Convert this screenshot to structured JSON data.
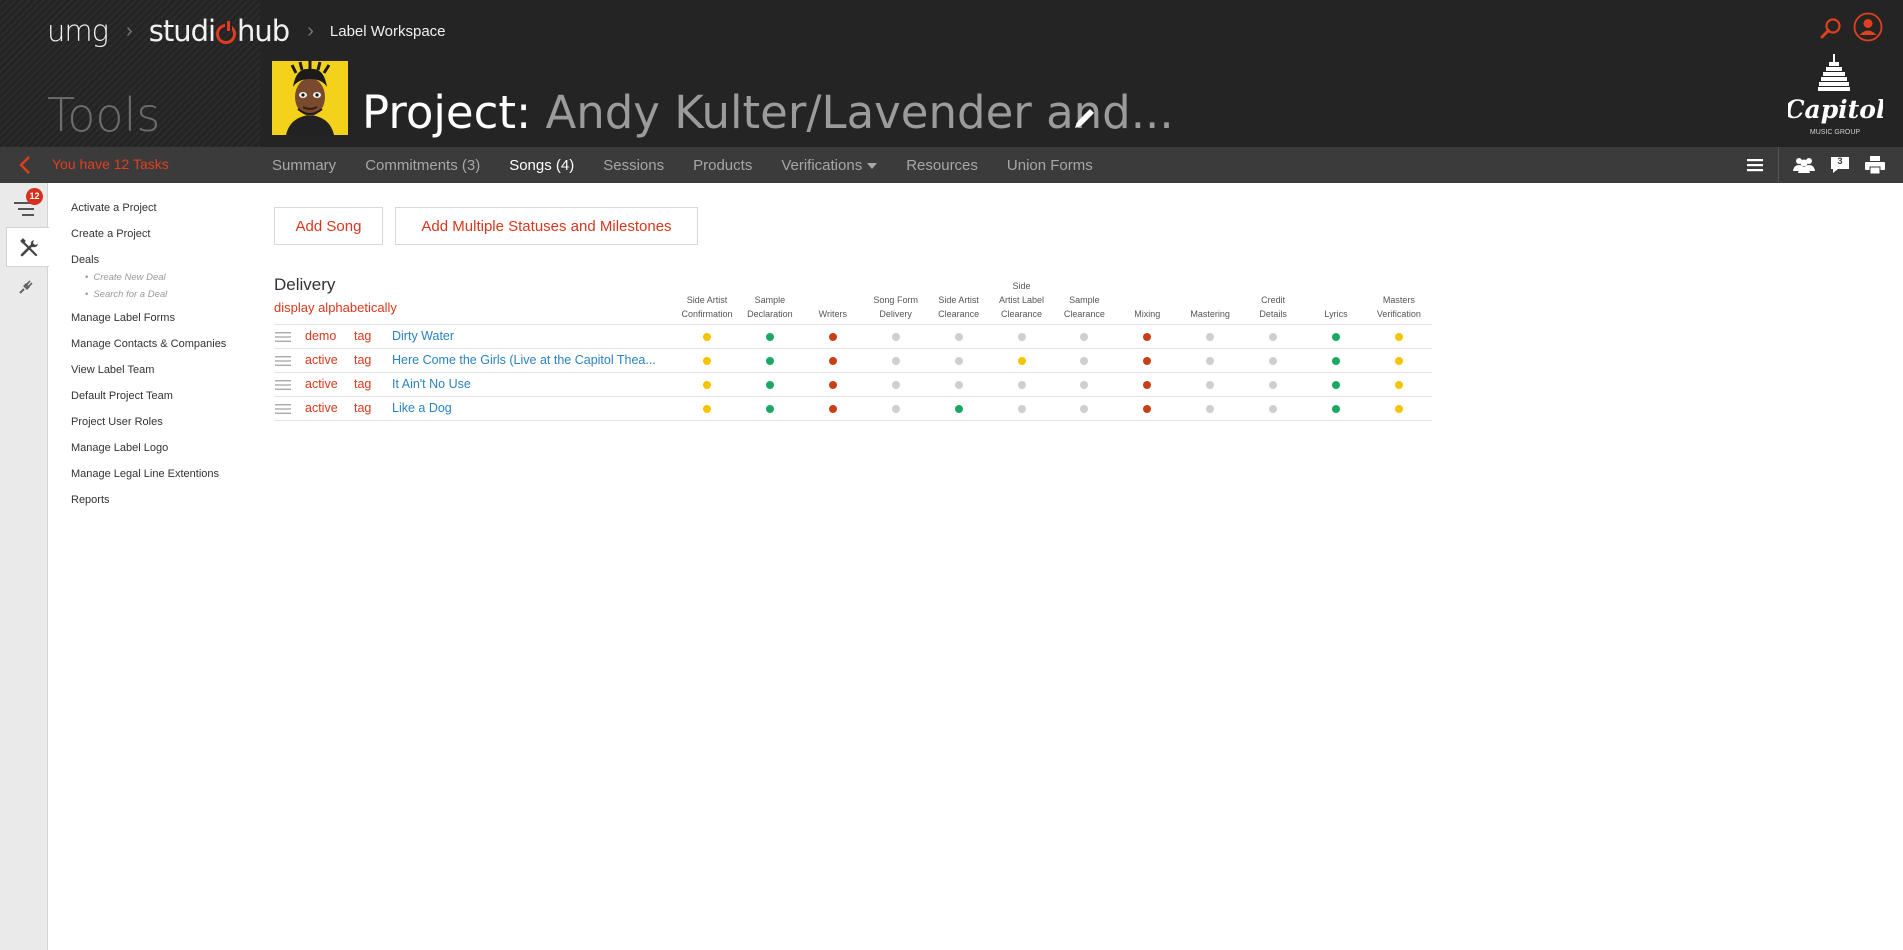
{
  "header": {
    "brand_primary": "umg",
    "brand_product_prefix": "studi",
    "brand_product_suffix": "hub",
    "breadcrumb": "Label Workspace",
    "section_title": "Tools",
    "project_prefix": "Project:",
    "project_name": "Andy Kulter/Lavender and...",
    "logo": {
      "script": "Capitol",
      "subtitle": "MUSIC GROUP"
    }
  },
  "nav": {
    "tasks_label": "You have 12 Tasks",
    "tabs": [
      {
        "label": "Summary"
      },
      {
        "label": "Commitments (3)"
      },
      {
        "label": "Songs (4)"
      },
      {
        "label": "Sessions"
      },
      {
        "label": "Products"
      },
      {
        "label": "Verifications"
      },
      {
        "label": "Resources"
      },
      {
        "label": "Union Forms"
      }
    ],
    "active_tab": "Songs (4)",
    "chat_count": "3"
  },
  "rail": {
    "tasks_badge": "12"
  },
  "tools_menu": {
    "items": [
      "Activate a Project",
      "Create a Project",
      "Deals",
      "Manage Label Forms",
      "Manage Contacts & Companies",
      "View Label Team",
      "Default Project Team",
      "Project User Roles",
      "Manage Label Logo",
      "Manage Legal Line Extentions",
      "Reports"
    ],
    "deal_subitems": [
      "Create New Deal",
      "Search for a Deal"
    ]
  },
  "actions": {
    "add_song": "Add Song",
    "add_multiple": "Add Multiple Statuses and Milestones"
  },
  "delivery": {
    "title": "Delivery",
    "sort_label": "display alphabetically",
    "columns": [
      [
        "Side Artist",
        "Confirmation"
      ],
      [
        "Sample",
        "Declaration"
      ],
      [
        "Writers"
      ],
      [
        "Song Form",
        "Delivery"
      ],
      [
        "Side Artist",
        "Clearance"
      ],
      [
        "Side",
        "Artist Label",
        "Clearance"
      ],
      [
        "Sample",
        "Clearance"
      ],
      [
        "Mixing"
      ],
      [
        "Mastering"
      ],
      [
        "Credit",
        "Details"
      ],
      [
        "Lyrics"
      ],
      [
        "Masters",
        "Verification"
      ]
    ],
    "status_colors": {
      "yellow": "#f5c400",
      "green": "#1aa862",
      "red": "#c8401a",
      "gray": "#cfcfcf"
    },
    "rows": [
      {
        "status": "demo",
        "tag": "tag",
        "title": "Dirty Water",
        "statuses": [
          "yellow",
          "green",
          "red",
          "gray",
          "gray",
          "gray",
          "gray",
          "red",
          "gray",
          "gray",
          "green",
          "yellow"
        ]
      },
      {
        "status": "active",
        "tag": "tag",
        "title": "Here Come the Girls (Live at the Capitol Thea...",
        "statuses": [
          "yellow",
          "green",
          "red",
          "gray",
          "gray",
          "yellow",
          "gray",
          "red",
          "gray",
          "gray",
          "green",
          "yellow"
        ]
      },
      {
        "status": "active",
        "tag": "tag",
        "title": "It Ain't No Use",
        "statuses": [
          "yellow",
          "green",
          "red",
          "gray",
          "gray",
          "gray",
          "gray",
          "red",
          "gray",
          "gray",
          "green",
          "yellow"
        ]
      },
      {
        "status": "active",
        "tag": "tag",
        "title": "Like a Dog",
        "statuses": [
          "yellow",
          "green",
          "red",
          "gray",
          "green",
          "gray",
          "gray",
          "red",
          "gray",
          "gray",
          "green",
          "yellow"
        ]
      }
    ]
  },
  "colors": {
    "accent": "#d7371b",
    "link": "#2a83c0",
    "header_bg": "#242424",
    "nav_bg": "#3b3b3b"
  }
}
